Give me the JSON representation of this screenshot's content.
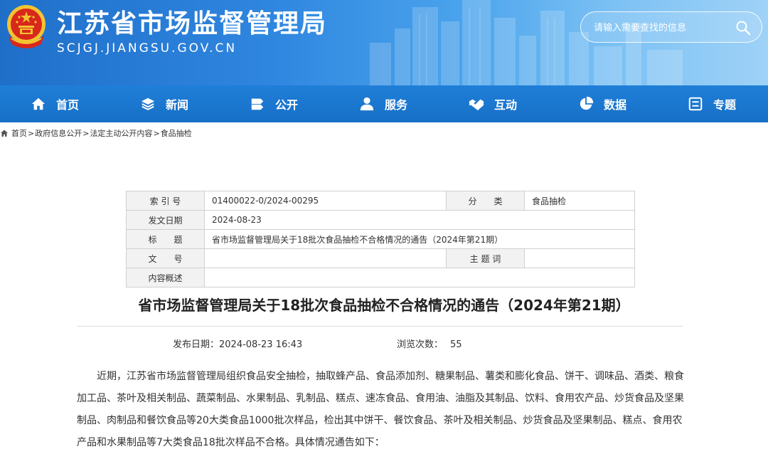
{
  "header": {
    "site_title": "江苏省市场监督管理局",
    "site_domain": "SCJGJ.JIANGSU.GOV.CN",
    "search_placeholder": "请输入需要查找的信息"
  },
  "colors": {
    "banner_blue": "#1f6fc9",
    "nav_blue": "#1a76cf",
    "emblem_red": "#d8281c",
    "emblem_gold": "#f3c431"
  },
  "nav": [
    {
      "label": "首页",
      "icon": "home-icon"
    },
    {
      "label": "新闻",
      "icon": "layers-icon"
    },
    {
      "label": "公开",
      "icon": "disclosure-icon"
    },
    {
      "label": "服务",
      "icon": "user-icon"
    },
    {
      "label": "互动",
      "icon": "handshake-icon"
    },
    {
      "label": "数据",
      "icon": "pie-chart-icon"
    },
    {
      "label": "专题",
      "icon": "topic-icon"
    }
  ],
  "breadcrumb": {
    "items": [
      "首页",
      "政府信息公开",
      "法定主动公开内容",
      "食品抽检"
    ],
    "separator": ">"
  },
  "meta": {
    "index_label": "索 引 号",
    "index_value": "01400022-0/2024-00295",
    "category_label": "分　　类",
    "category_value": "食品抽检",
    "date_label": "发文日期",
    "date_value": "2024-08-23",
    "title_label": "标　　题",
    "title_value": "省市场监督管理局关于18批次食品抽检不合格情况的通告（2024年第21期）",
    "docno_label": "文　　号",
    "docno_value": "",
    "subject_label": "主 题 词",
    "subject_value": "",
    "summary_label": "内容概述",
    "summary_value": ""
  },
  "article": {
    "title": "省市场监督管理局关于18批次食品抽检不合格情况的通告（2024年第21期）",
    "publish_label": "发布日期：",
    "publish_value": "2024-08-23 16:43",
    "views_label": "浏览次数：",
    "views_value": "55",
    "body": "近期，江苏省市场监督管理局组织食品安全抽检，抽取蜂产品、食品添加剂、糖果制品、薯类和膨化食品、饼干、调味品、酒类、粮食加工品、茶叶及相关制品、蔬菜制品、水果制品、乳制品、糕点、速冻食品、食用油、油脂及其制品、饮料、食用农产品、炒货食品及坚果制品、肉制品和餐饮食品等20大类食品1000批次样品，检出其中饼干、餐饮食品、茶叶及相关制品、炒货食品及坚果制品、糕点、食用农产品和水果制品等7大类食品18批次样品不合格。具体情况通告如下："
  }
}
